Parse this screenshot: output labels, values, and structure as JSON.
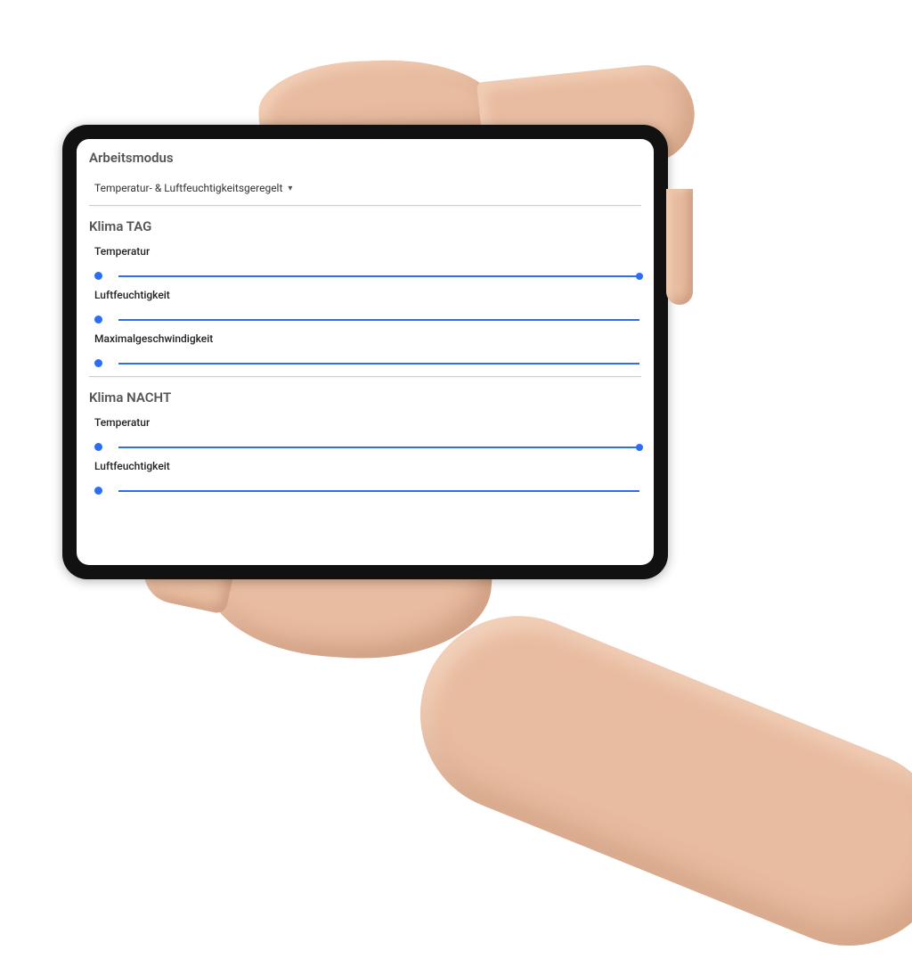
{
  "sections": {
    "arbeitsmodus": {
      "title": "Arbeitsmodus",
      "dropdown_label": "Temperatur- & Luftfeuchtigkeitsgeregelt"
    },
    "klima_tag": {
      "title": "Klima TAG",
      "fields": {
        "temperatur_label": "Temperatur",
        "luftfeuchtigkeit_label": "Luftfeuchtigkeit",
        "maximalgeschwindigkeit_label": "Maximalgeschwindigkeit"
      }
    },
    "klima_nacht": {
      "title": "Klima NACHT",
      "fields": {
        "temperatur_label": "Temperatur",
        "luftfeuchtigkeit_label": "Luftfeuchtigkeit"
      }
    }
  },
  "colors": {
    "accent": "#2b6df4"
  }
}
